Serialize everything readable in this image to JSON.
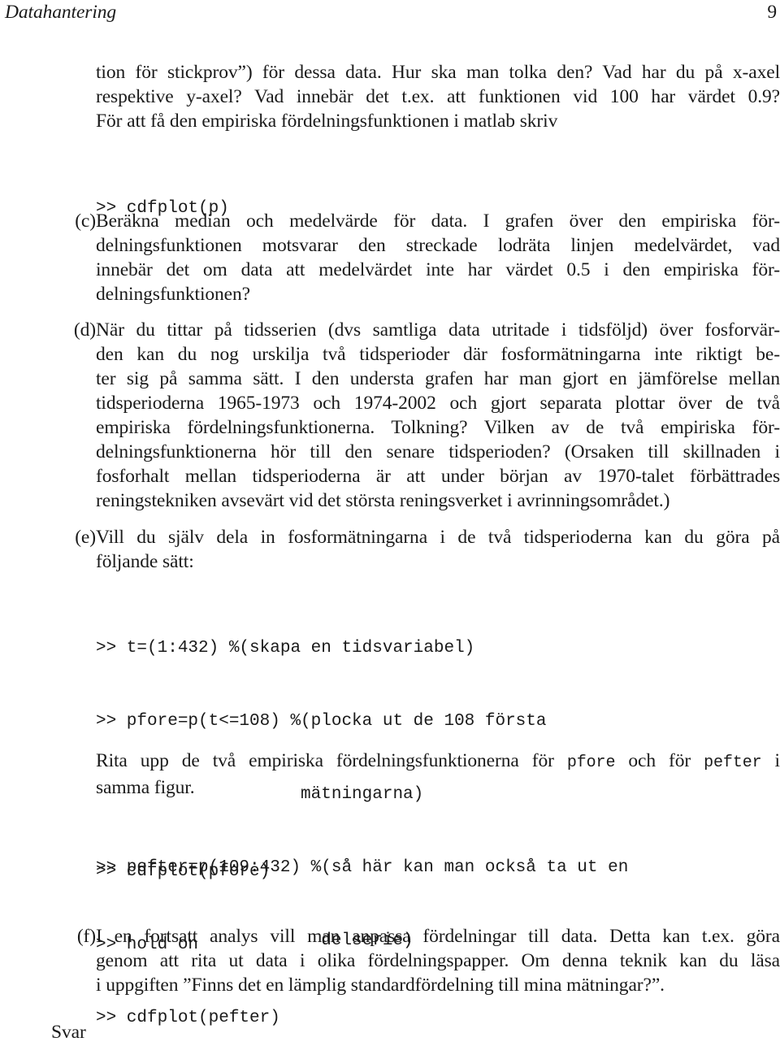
{
  "header": {
    "title": "Datahantering",
    "page_number": "9"
  },
  "intro": {
    "lines": [
      "tion för stickprov”) för dessa data. Hur ska man tolka den? Vad har du på x-axel",
      "respektive y-axel? Vad innebär det t.ex. att funktionen vid 100 har värdet 0.9?",
      "För att få den empiriska fördelningsfunktionen i matlab skriv"
    ],
    "code": ">> cdfplot(p)"
  },
  "items": {
    "c": {
      "label": "(c)",
      "text": "Beräkna median och medelvärde för data. I grafen över den empiriska fördelningsfunktionen motsvarar den streckade lodräta linjen medelvärdet, vad innebär det om data att medelvärdet inte har värdet 0.5 i den empiriska fördelningsfunktionen?",
      "lines": [
        "Beräkna median och medelvärde för data. I grafen över den empiriska för-",
        "delningsfunktionen motsvarar den streckade lodräta linjen medelvärdet, vad",
        "innebär det om data att medelvärdet inte har värdet 0.5 i den empiriska för-",
        "delningsfunktionen?"
      ]
    },
    "d": {
      "label": "(d)",
      "lines": [
        "När du tittar på tidsserien (dvs samtliga data utritade i tidsföljd) över fosforvär-",
        "den kan du nog urskilja två tidsperioder där fosformätningarna inte riktigt be-",
        "ter sig på samma sätt. I den understa grafen har man gjort en jämförelse mellan",
        "tidsperioderna 1965-1973 och 1974-2002 och gjort separata plottar över de två",
        "empiriska fördelningsfunktionerna. Tolkning? Vilken av de två empiriska för-",
        "delningsfunktionerna hör till den senare tidsperioden? (Orsaken till skillnaden i",
        "fosforhalt mellan tidsperioderna är att under början av 1970-talet förbättrades",
        "reningstekniken avsevärt vid det största reningsverket i avrinningsområdet.)"
      ]
    },
    "e": {
      "label": "(e)",
      "lines": [
        "Vill du själv dela in fosformätningarna i de två tidsperioderna kan du göra på",
        "följande sätt:"
      ],
      "code": [
        ">> t=(1:432) %(skapa en tidsvariabel)",
        ">> pfore=p(t<=108) %(plocka ut de 108 första",
        "                    mätningarna)",
        ">> pefter=p(109:432) %(så här kan man också ta ut en",
        "                      delserie)"
      ],
      "instruction": {
        "before_pfore": "Rita upp de två empiriska fördelningsfunktionerna för ",
        "pfore": "pfore",
        "between": " och för ",
        "pefter": "pefter",
        "after_pefter": " i",
        "line2": "samma figur."
      },
      "code2": [
        ">> cdfplot(pfore)",
        ">> hold on",
        ">> cdfplot(pefter)"
      ]
    },
    "f": {
      "label": "(f)",
      "lines": [
        "I en fortsatt analys vill man anpassa fördelningar till data. Detta kan t.ex. göra",
        "genom att rita ut data i olika fördelningspapper. Om denna teknik kan du läsa",
        "i uppgiften ”Finns det en lämplig standardfördelning till mina mätningar?”."
      ]
    }
  },
  "footer": {
    "svar_label": "Svar"
  }
}
